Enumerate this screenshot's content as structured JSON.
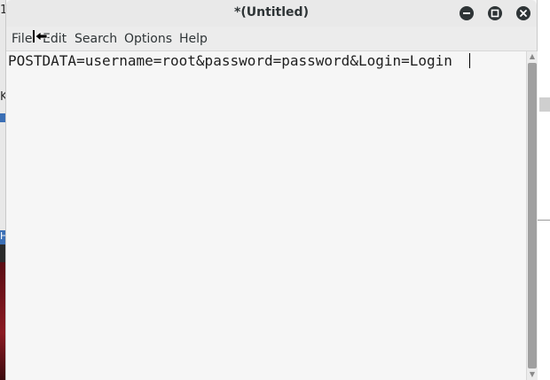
{
  "window": {
    "title": "*(Untitled)"
  },
  "controls": {
    "minimize_icon": "minimize-icon",
    "maximize_icon": "maximize-icon",
    "close_icon": "close-icon"
  },
  "menu": {
    "items": [
      {
        "label": "File"
      },
      {
        "label": "Edit"
      },
      {
        "label": "Search"
      },
      {
        "label": "Options"
      },
      {
        "label": "Help"
      }
    ]
  },
  "editor": {
    "content": "POSTDATA=username=root&password=password&Login=Login"
  },
  "background": {
    "glyph_top": "1",
    "glyph_k": "K",
    "glyph_h": "H"
  },
  "colors": {
    "titlebar": "#e9e9e9",
    "editor_bg": "#f6f6f6",
    "control_button": "#2e3436"
  }
}
